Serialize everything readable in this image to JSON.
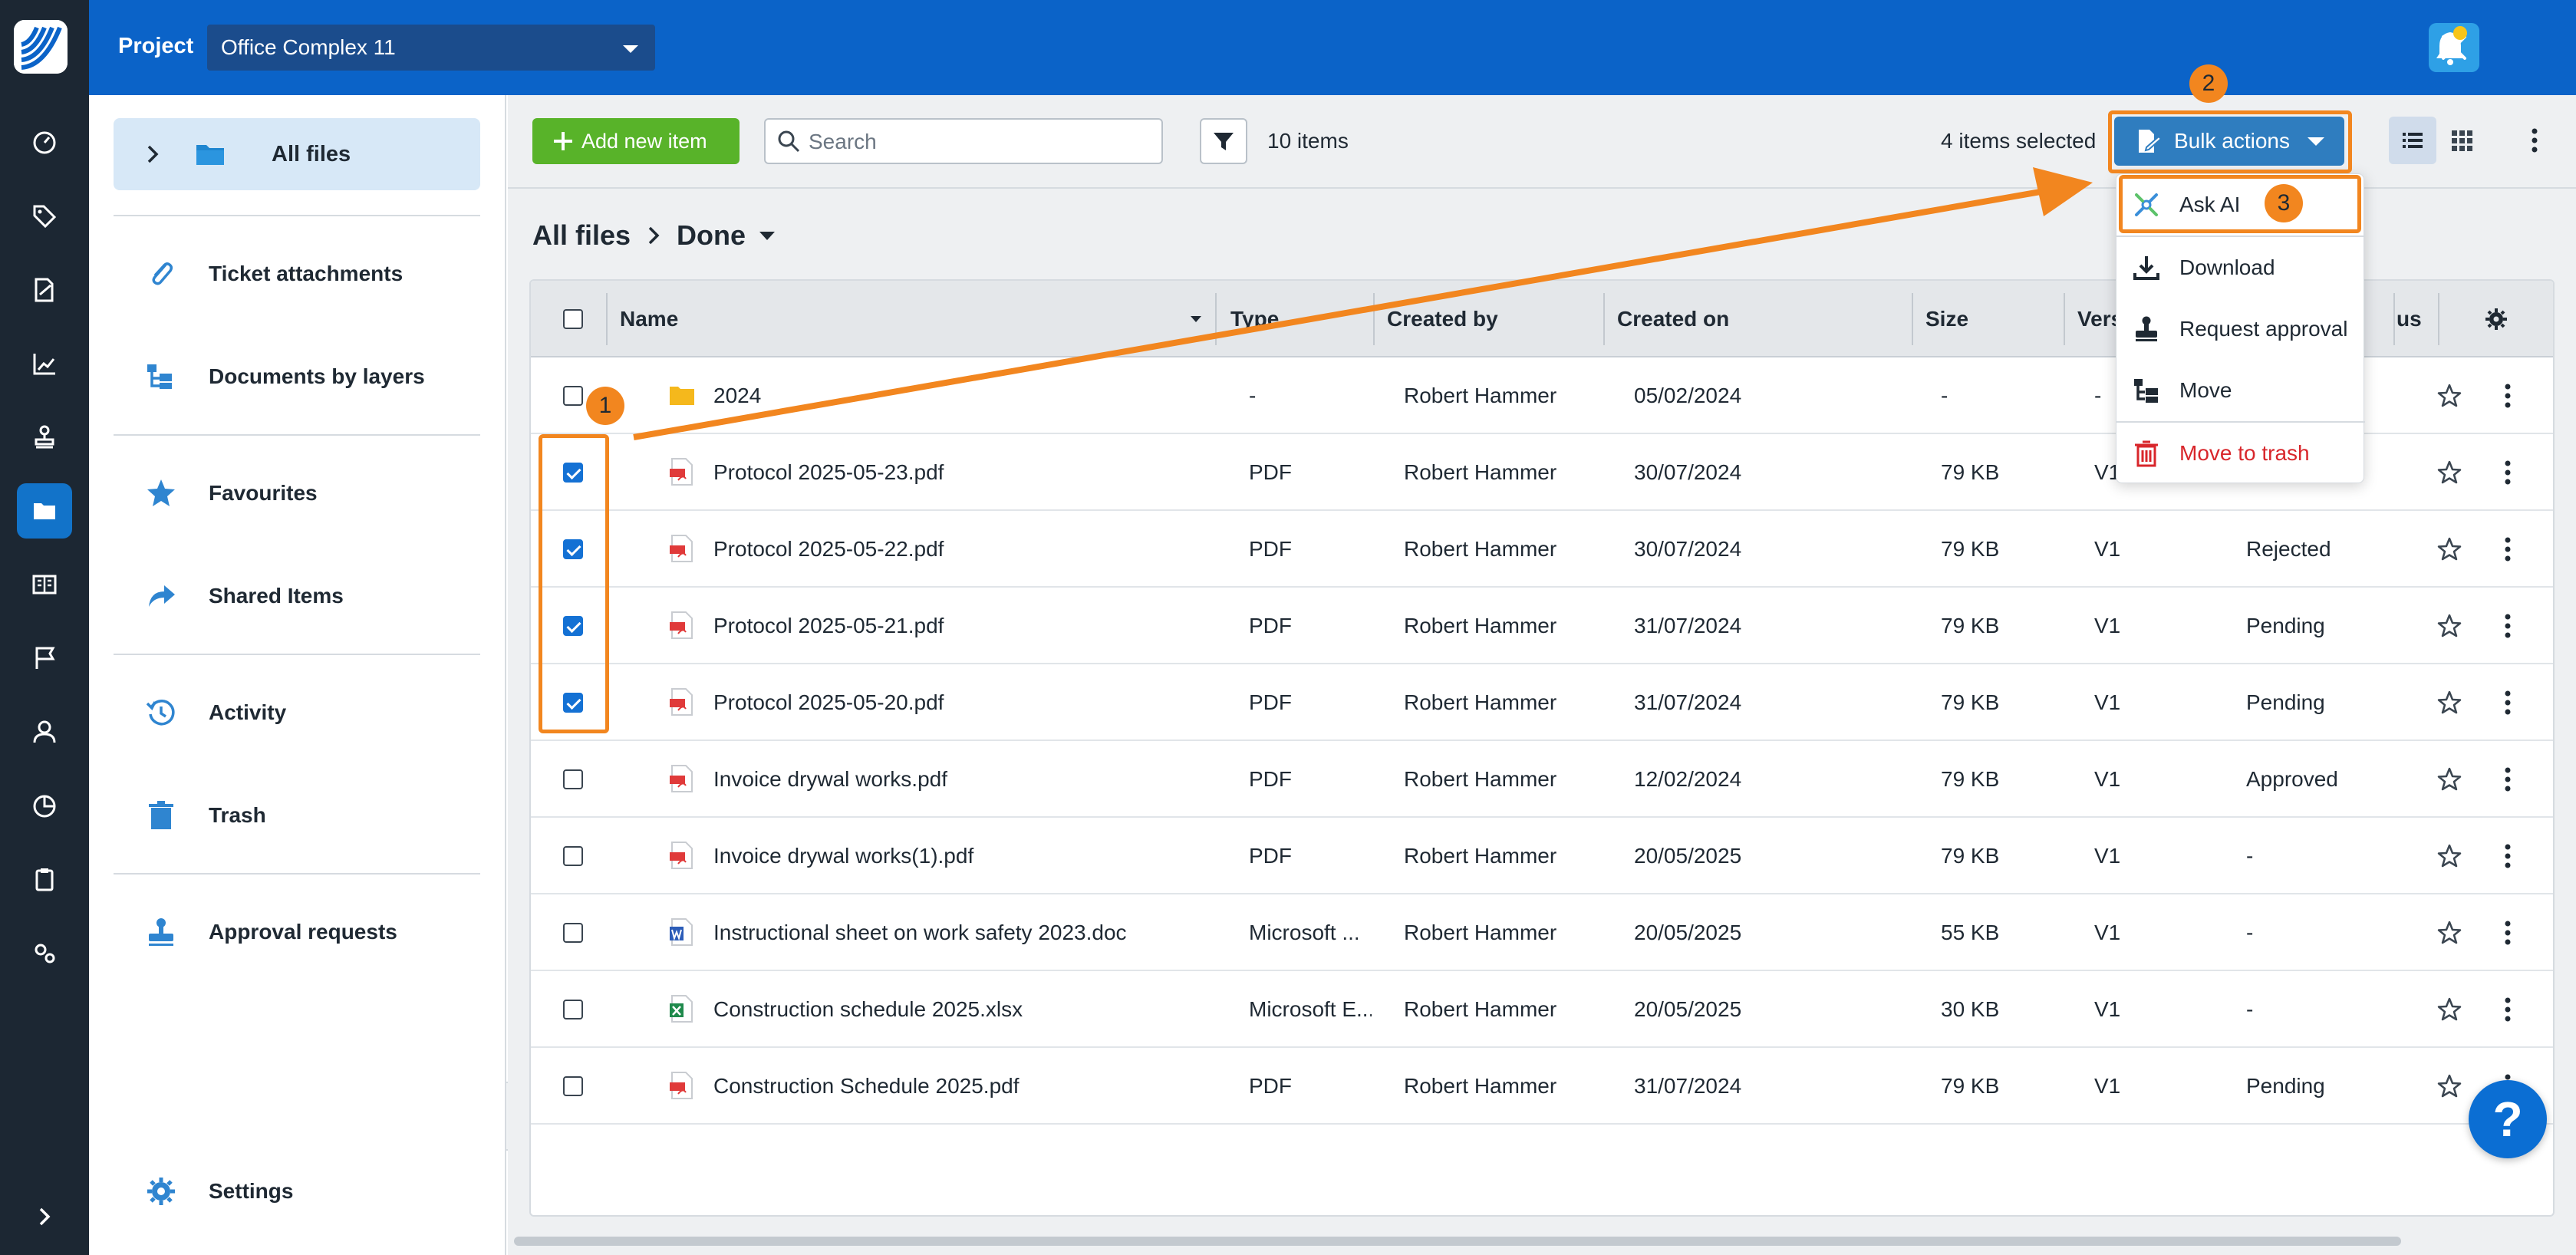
{
  "topbar": {
    "project_label": "Project",
    "project_value": "Office Complex 11"
  },
  "sidenav": {
    "items": [
      {
        "label": "All files",
        "icon": "folder-icon"
      },
      {
        "label": "Ticket attachments",
        "icon": "paperclip-icon"
      },
      {
        "label": "Documents by layers",
        "icon": "layers-tree-icon"
      },
      {
        "label": "Favourites",
        "icon": "star-icon"
      },
      {
        "label": "Shared Items",
        "icon": "share-arrow-icon"
      },
      {
        "label": "Activity",
        "icon": "history-icon"
      },
      {
        "label": "Trash",
        "icon": "trash-icon"
      },
      {
        "label": "Approval requests",
        "icon": "stamp-icon"
      },
      {
        "label": "Settings",
        "icon": "gear-icon"
      }
    ]
  },
  "toolbar": {
    "add_label": "Add new item",
    "search_placeholder": "Search",
    "items_count": "10 items",
    "selected_count": "4 items selected",
    "bulk_label": "Bulk actions"
  },
  "breadcrumb": {
    "root": "All files",
    "current": "Done"
  },
  "table": {
    "columns": {
      "name": "Name",
      "type": "Type",
      "created_by": "Created by",
      "created_on": "Created on",
      "size": "Size",
      "version": "Vers",
      "status": "us"
    },
    "rows": [
      {
        "name": "2024",
        "kind": "folder",
        "type": "-",
        "created_by": "Robert Hammer",
        "created_on": "05/02/2024",
        "size": "-",
        "version": "-",
        "status": "",
        "checked": false
      },
      {
        "name": "Protocol 2025-05-23.pdf",
        "kind": "pdf",
        "type": "PDF",
        "created_by": "Robert Hammer",
        "created_on": "30/07/2024",
        "size": "79 KB",
        "version": "V1",
        "status": "",
        "checked": true
      },
      {
        "name": "Protocol 2025-05-22.pdf",
        "kind": "pdf",
        "type": "PDF",
        "created_by": "Robert Hammer",
        "created_on": "30/07/2024",
        "size": "79 KB",
        "version": "V1",
        "status": "Rejected",
        "checked": true
      },
      {
        "name": "Protocol 2025-05-21.pdf",
        "kind": "pdf",
        "type": "PDF",
        "created_by": "Robert Hammer",
        "created_on": "31/07/2024",
        "size": "79 KB",
        "version": "V1",
        "status": "Pending",
        "checked": true
      },
      {
        "name": "Protocol 2025-05-20.pdf",
        "kind": "pdf",
        "type": "PDF",
        "created_by": "Robert Hammer",
        "created_on": "31/07/2024",
        "size": "79 KB",
        "version": "V1",
        "status": "Pending",
        "checked": true
      },
      {
        "name": "Invoice drywal works.pdf",
        "kind": "pdf",
        "type": "PDF",
        "created_by": "Robert Hammer",
        "created_on": "12/02/2024",
        "size": "79 KB",
        "version": "V1",
        "status": "Approved",
        "checked": false
      },
      {
        "name": "Invoice drywal works(1).pdf",
        "kind": "pdf",
        "type": "PDF",
        "created_by": "Robert Hammer",
        "created_on": "20/05/2025",
        "size": "79 KB",
        "version": "V1",
        "status": "-",
        "checked": false
      },
      {
        "name": "Instructional sheet on work safety 2023.doc",
        "kind": "doc",
        "type": "Microsoft ...",
        "created_by": "Robert Hammer",
        "created_on": "20/05/2025",
        "size": "55 KB",
        "version": "V1",
        "status": "-",
        "checked": false
      },
      {
        "name": "Construction schedule 2025.xlsx",
        "kind": "xls",
        "type": "Microsoft E...",
        "created_by": "Robert Hammer",
        "created_on": "20/05/2025",
        "size": "30 KB",
        "version": "V1",
        "status": "-",
        "checked": false
      },
      {
        "name": "Construction Schedule 2025.pdf",
        "kind": "pdf",
        "type": "PDF",
        "created_by": "Robert Hammer",
        "created_on": "31/07/2024",
        "size": "79 KB",
        "version": "V1",
        "status": "Pending",
        "checked": false
      }
    ]
  },
  "bulk_menu": {
    "items": [
      {
        "label": "Ask AI",
        "icon": "ai-sparkle-icon",
        "danger": false
      },
      {
        "label": "Download",
        "icon": "download-icon",
        "danger": false
      },
      {
        "label": "Request approval",
        "icon": "stamp-icon",
        "danger": false
      },
      {
        "label": "Move",
        "icon": "move-tree-icon",
        "danger": false
      },
      {
        "label": "Move to trash",
        "icon": "trash-icon",
        "danger": true
      }
    ]
  },
  "annotations": {
    "step1": "1",
    "step2": "2",
    "step3": "3"
  },
  "help_label": "?",
  "colors": {
    "brand_blue": "#0b63c8",
    "rail_dark": "#1c2733",
    "add_green": "#58b329",
    "annotation_orange": "#f2861f",
    "danger_red": "#d8262b"
  }
}
